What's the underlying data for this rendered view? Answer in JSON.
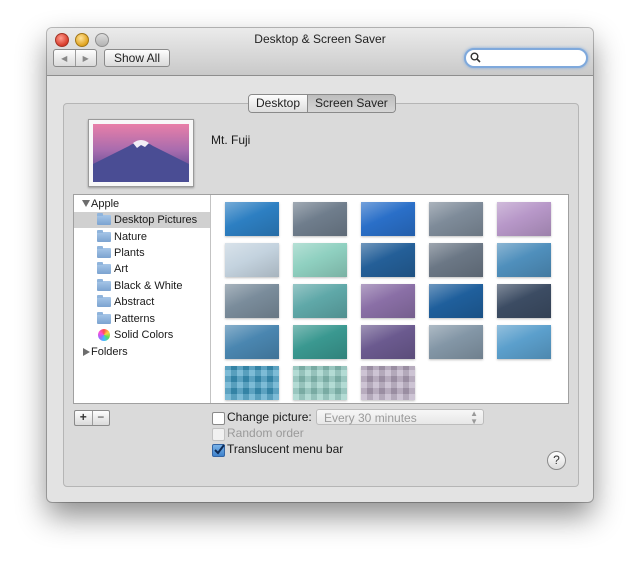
{
  "window": {
    "title": "Desktop & Screen Saver"
  },
  "toolbar": {
    "back_glyph": "◀",
    "forward_glyph": "▶",
    "show_all_label": "Show All",
    "search_placeholder": ""
  },
  "tabs": [
    {
      "label": "Desktop",
      "selected": false
    },
    {
      "label": "Screen Saver",
      "selected": true
    }
  ],
  "preview": {
    "title": "Mt. Fuji"
  },
  "sidebar": {
    "groups": [
      {
        "label": "Apple",
        "expanded": true,
        "items": [
          {
            "label": "Desktop Pictures",
            "icon": "folder-icon",
            "selected": true
          },
          {
            "label": "Nature",
            "icon": "folder-icon"
          },
          {
            "label": "Plants",
            "icon": "folder-icon"
          },
          {
            "label": "Art",
            "icon": "folder-icon"
          },
          {
            "label": "Black & White",
            "icon": "folder-icon"
          },
          {
            "label": "Abstract",
            "icon": "folder-icon"
          },
          {
            "label": "Patterns",
            "icon": "folder-icon"
          },
          {
            "label": "Solid Colors",
            "icon": "color-wheel-icon"
          }
        ]
      },
      {
        "label": "Folders",
        "expanded": false,
        "items": []
      }
    ]
  },
  "buttons": {
    "add_label": "+",
    "remove_label": "−",
    "help_label": "?"
  },
  "options": {
    "change_picture": {
      "label": "Change picture:",
      "checked": false
    },
    "interval": {
      "value": "Every 30 minutes",
      "enabled": false
    },
    "random_order": {
      "label": "Random order",
      "checked": false,
      "enabled": false
    },
    "translucent_menu_bar": {
      "label": "Translucent menu bar",
      "checked": true
    }
  },
  "colors": {
    "accent": "#3e82cc",
    "thumbnails": [
      "#2d7fc2",
      "#6f7d8c",
      "#2a6fc8",
      "#7e8b99",
      "#b797c8",
      "#c4d3df",
      "#8fd0c0",
      "#245f98",
      "#6b7785",
      "#4f8fbc",
      "#7a8c9b",
      "#5fa8a8",
      "#8a6fa6",
      "#1f5f9c",
      "#3c4c63",
      "#4a86b0",
      "#3a9890",
      "#6b5a8f",
      "#8396a6",
      "#5b9fcc",
      "#3d9ac2",
      "#8ec9c0",
      "#b5a7bf"
    ]
  }
}
